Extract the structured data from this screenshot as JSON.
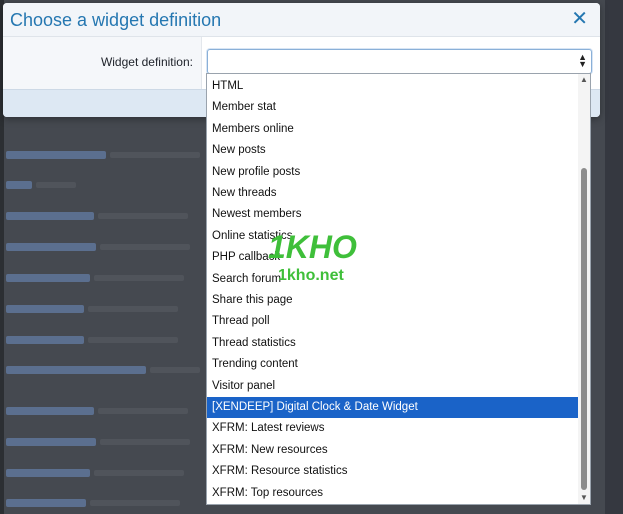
{
  "dialog": {
    "title": "Choose a widget definition",
    "close_symbol": "✕",
    "field_label": "Widget definition:",
    "select_value": ""
  },
  "dropdown": {
    "options": [
      "HTML",
      "Member stat",
      "Members online",
      "New posts",
      "New profile posts",
      "New threads",
      "Newest members",
      "Online statistics",
      "PHP callback",
      "Search forum",
      "Share this page",
      "Thread poll",
      "Thread statistics",
      "Trending content",
      "Visitor panel",
      "[XENDEEP] Digital Clock & Date Widget",
      "XFRM: Latest reviews",
      "XFRM: New resources",
      "XFRM: Resource statistics",
      "XFRM: Top resources"
    ],
    "selected_index": 15
  },
  "watermark": {
    "logo_text": "1KHO",
    "site_text": "1kho.net"
  },
  "colors": {
    "accent": "#2577b1",
    "selected_bg": "#1a63c8",
    "watermark_green": "#3fbf3a"
  },
  "icons": {
    "close": "close-icon",
    "select_arrows": "chevron-up-down-icon",
    "scroll_up": "triangle-up-icon",
    "scroll_down": "triangle-down-icon"
  }
}
